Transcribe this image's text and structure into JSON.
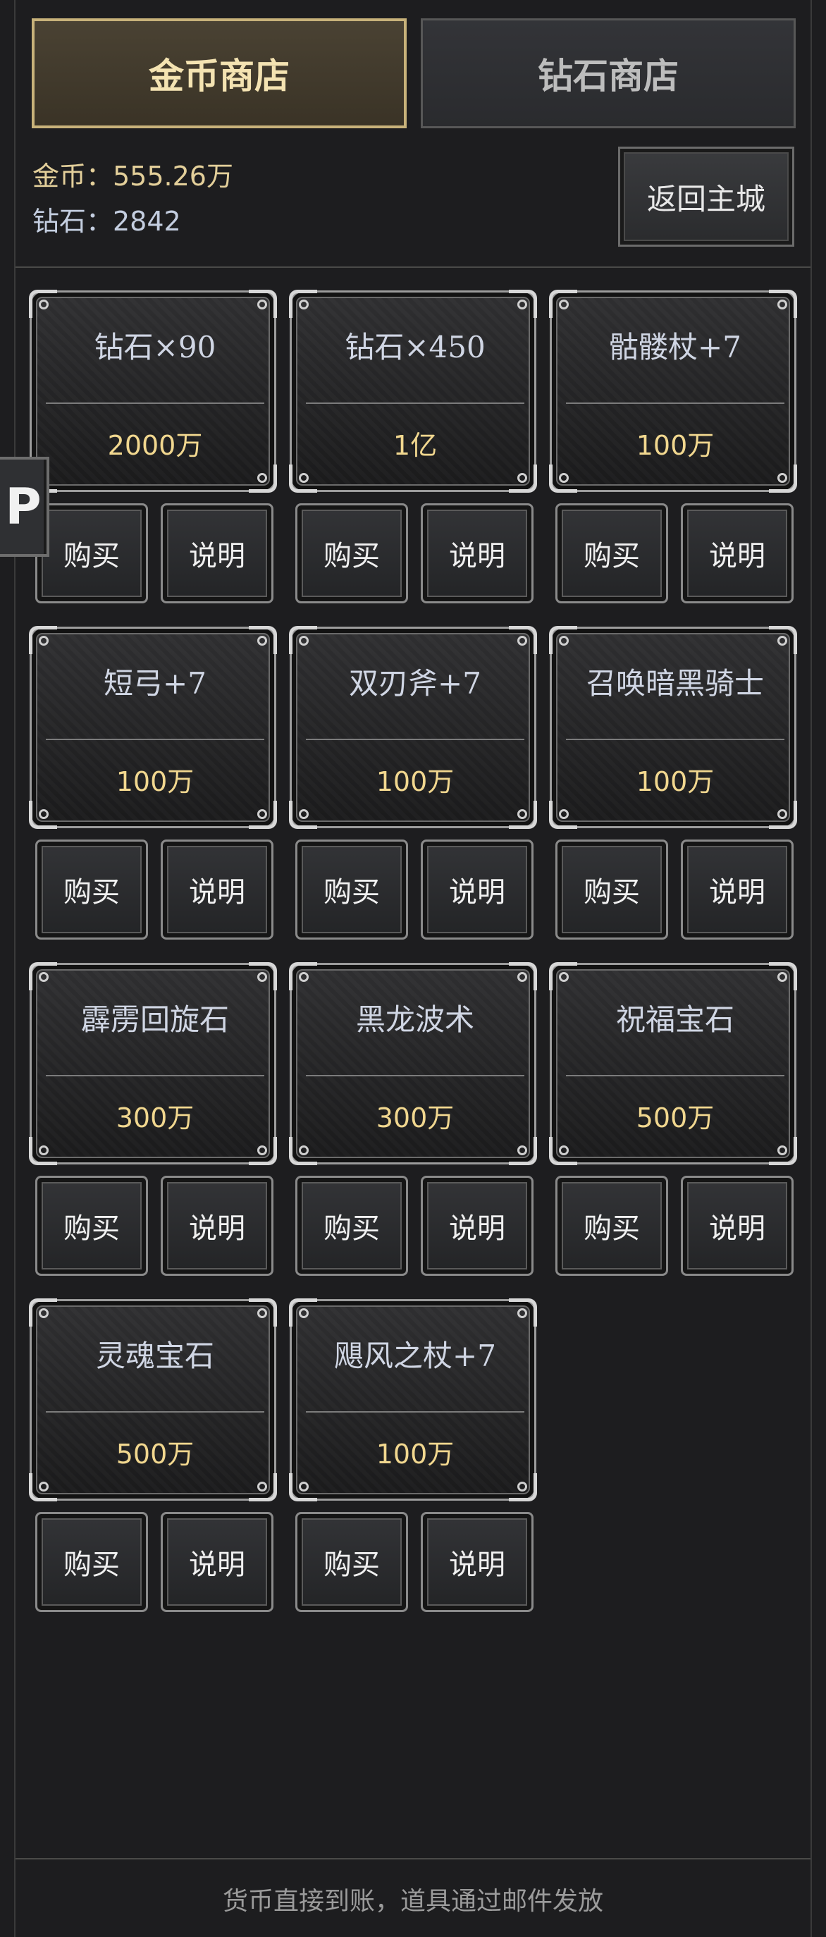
{
  "tabs": {
    "gold_shop": "金币商店",
    "diamond_shop": "钻石商店"
  },
  "wallet": {
    "gold_line": "金币：555.26万",
    "diamond_line": "钻石：2842"
  },
  "home_button": "返回主城",
  "side_tab": "P",
  "buttons": {
    "buy": "购买",
    "info": "说明"
  },
  "items": [
    {
      "name": "钻石×90",
      "price": "2000万"
    },
    {
      "name": "钻石×450",
      "price": "1亿"
    },
    {
      "name": "骷髅杖+7",
      "price": "100万"
    },
    {
      "name": "短弓+7",
      "price": "100万"
    },
    {
      "name": "双刃斧+7",
      "price": "100万"
    },
    {
      "name": "召唤暗黑骑士",
      "price": "100万"
    },
    {
      "name": "霹雳回旋石",
      "price": "300万"
    },
    {
      "name": "黑龙波术",
      "price": "300万"
    },
    {
      "name": "祝福宝石",
      "price": "500万"
    },
    {
      "name": "灵魂宝石",
      "price": "500万"
    },
    {
      "name": "飓风之杖+7",
      "price": "100万"
    }
  ],
  "footer": "货币直接到账，道具通过邮件发放"
}
